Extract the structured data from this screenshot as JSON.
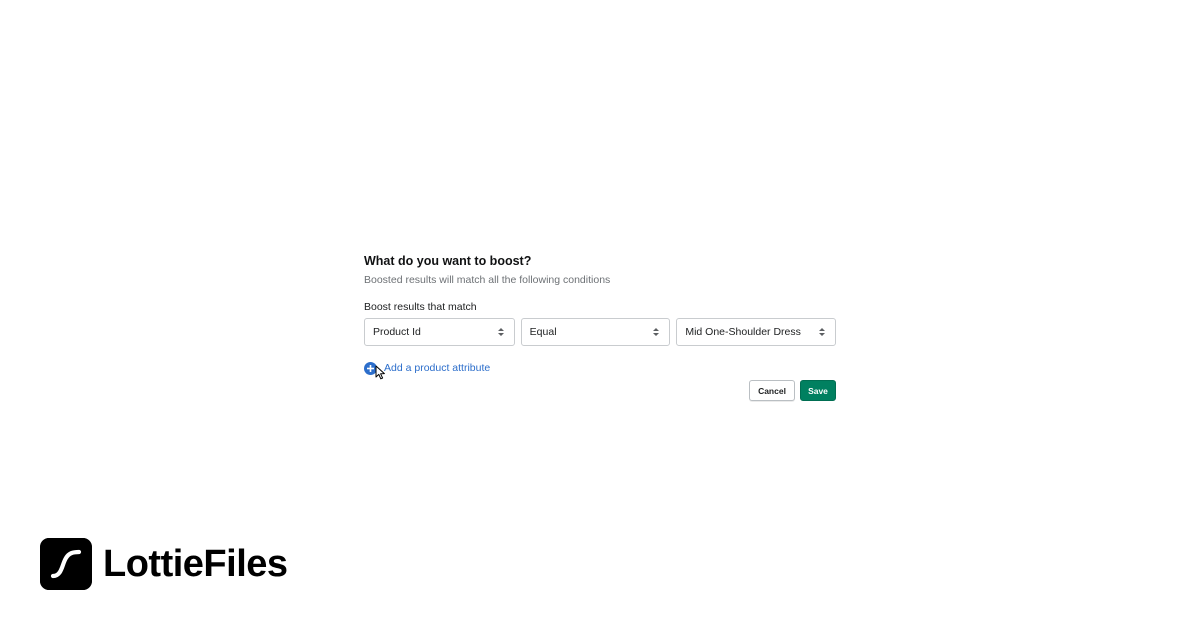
{
  "form": {
    "title": "What do you want to boost?",
    "subtitle": "Boosted results will match all the following conditions",
    "match_label": "Boost results that match",
    "conditions": [
      {
        "attribute": "Product Id",
        "operator": "Equal",
        "value": "Mid One-Shoulder Dress"
      }
    ],
    "add_attribute_label": "Add a product attribute",
    "cancel_label": "Cancel",
    "save_label": "Save"
  },
  "icons": {
    "add": "plus-circle-icon",
    "select_arrows": "chevron-up-down-icon",
    "cursor": "mouse-pointer-icon",
    "brand": "lottiefiles-logo-icon"
  },
  "brand": {
    "name": "LottieFiles"
  },
  "colors": {
    "link": "#2c6ecb",
    "primary_button": "#008060",
    "border": "#c9cccf",
    "muted_text": "#6d7175"
  }
}
